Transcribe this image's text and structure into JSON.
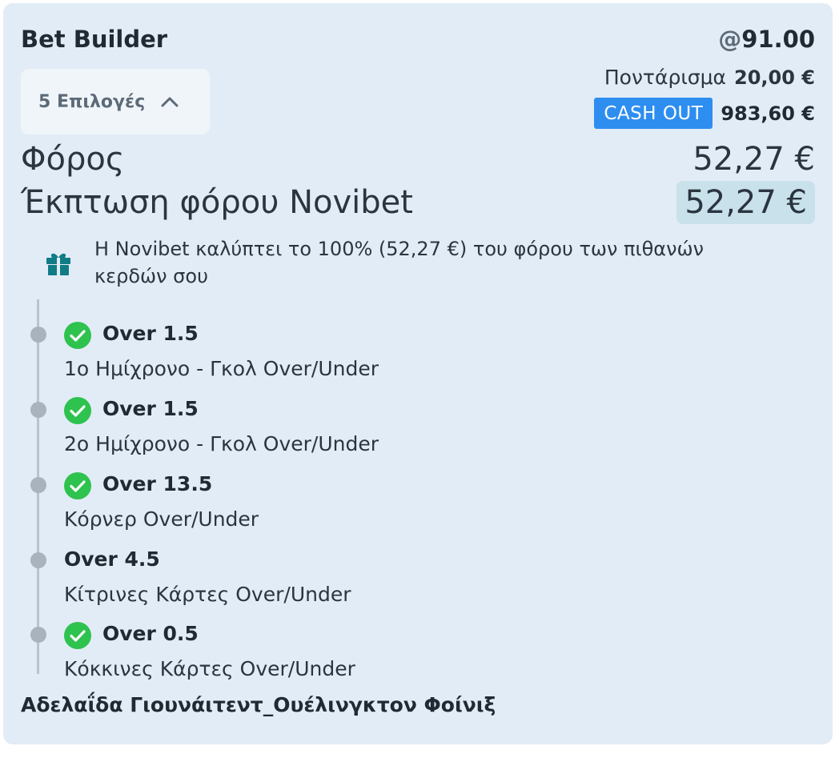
{
  "header": {
    "title": "Bet Builder",
    "odds_prefix": "@",
    "odds_value": "91.00"
  },
  "selections_button": {
    "label": "5 Επιλογές",
    "icon": "chevron-up-icon"
  },
  "stake": {
    "label": "Ποντάρισμα",
    "amount": "20,00 €"
  },
  "cashout": {
    "label": "CASH OUT",
    "amount": "983,60 €"
  },
  "tax": {
    "label": "Φόρος",
    "amount": "52,27 €"
  },
  "tax_rebate": {
    "label": "Έκπτωση φόρου Novibet",
    "amount": "52,27 €"
  },
  "info": {
    "icon": "gift-icon",
    "text": "Η Novibet καλύπτει το 100% (52,27 €) του φόρου των πιθανών κερδών σου"
  },
  "legs": [
    {
      "title": "Over 1.5",
      "market": "1ο Ημίχρονο - Γκολ Over/Under",
      "won": true
    },
    {
      "title": "Over 1.5",
      "market": "2ο Ημίχρονο - Γκολ Over/Under",
      "won": true
    },
    {
      "title": "Over 13.5",
      "market": "Κόρνερ Over/Under",
      "won": true
    },
    {
      "title": "Over 4.5",
      "market": "Κίτρινες Κάρτες Over/Under",
      "won": false
    },
    {
      "title": "Over 0.5",
      "market": "Κόκκινες Κάρτες Over/Under",
      "won": true
    }
  ],
  "match": {
    "name": "Αδελαΐδα Γιουνάιτεντ_Ουέλινγκτον Φοίνιξ"
  },
  "colors": {
    "card_bg": "#e2ecf6",
    "cashout_blue": "#2d8ef0",
    "check_green": "#2ec24e",
    "gift_teal": "#0f7c86",
    "rebate_highlight": "#c9e1ea"
  }
}
